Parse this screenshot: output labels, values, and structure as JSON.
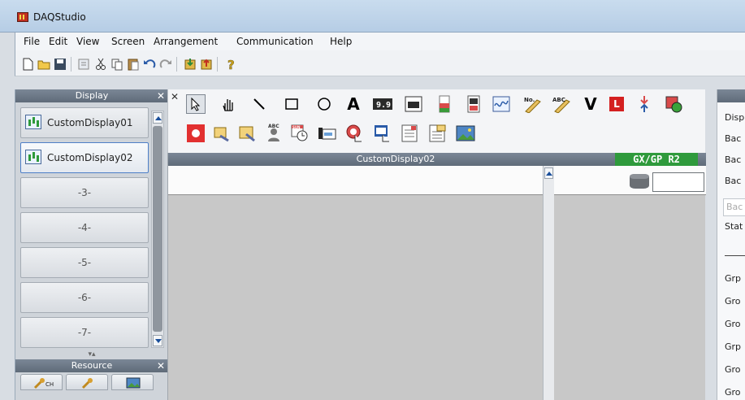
{
  "window": {
    "title": "DAQStudio"
  },
  "menu": [
    "File",
    "Edit",
    "View",
    "Screen",
    "Arrangement",
    "Communication",
    "Help"
  ],
  "display_panel": {
    "title": "Display",
    "items": [
      {
        "label": "CustomDisplay01",
        "selected": false,
        "has_icon": true
      },
      {
        "label": "CustomDisplay02",
        "selected": true,
        "has_icon": true
      },
      {
        "label": "-3-",
        "selected": false,
        "has_icon": false
      },
      {
        "label": "-4-",
        "selected": false,
        "has_icon": false
      },
      {
        "label": "-5-",
        "selected": false,
        "has_icon": false
      },
      {
        "label": "-6-",
        "selected": false,
        "has_icon": false
      },
      {
        "label": "-7-",
        "selected": false,
        "has_icon": false
      }
    ]
  },
  "resource_panel": {
    "title": "Resource",
    "tab1_sub": "CH"
  },
  "palette": {
    "text_tool": "A",
    "digital_label": "9.9",
    "abc_label": "ABC",
    "no_label": "No.",
    "v_label": "V",
    "l_label": "L",
    "sun_label": "SUN"
  },
  "canvas": {
    "title": "CustomDisplay02",
    "badge": "GX/GP  R2"
  },
  "properties": {
    "rows": [
      "Disp",
      "Bac",
      "Bac",
      "Bac",
      "Bac",
      "Stat",
      "Grp",
      "Gro",
      "Gro",
      "Grp",
      "Gro",
      "Gro"
    ],
    "placeholder_row": "Bac"
  },
  "colors": {
    "badge_green": "#2f9a3c",
    "panel_header": "#6b7785",
    "canvas_bg": "#c8c8c8"
  }
}
